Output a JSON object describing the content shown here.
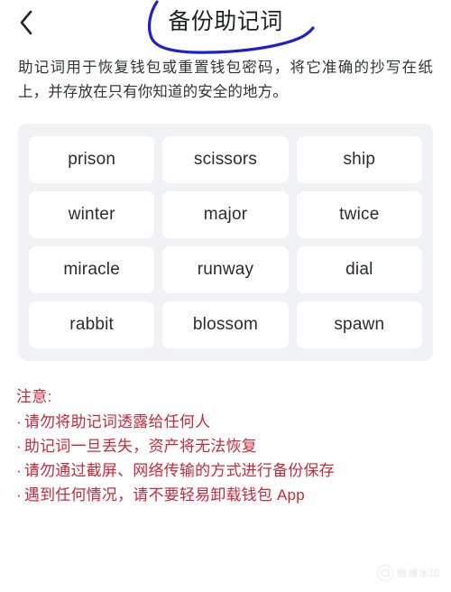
{
  "header": {
    "back_icon": "chevron-left-icon",
    "title": "备份助记词",
    "annotation_color": "#1f1fcc"
  },
  "description": "助记词用于恢复钱包或重置钱包密码，将它准确的抄写在纸上，并存放在只有你知道的安全的地方。",
  "mnemonic": {
    "panel_bg": "#f1f2f6",
    "chip_bg": "#ffffff",
    "rows": [
      [
        "prison",
        "scissors",
        "ship"
      ],
      [
        "winter",
        "major",
        "twice"
      ],
      [
        "miracle",
        "runway",
        "dial"
      ],
      [
        "rabbit",
        "blossom",
        "spawn"
      ]
    ]
  },
  "warning": {
    "color": "#c8293c",
    "title": "注意:",
    "bullet": "·",
    "items": [
      "请勿将助记词透露给任何人",
      "助记词一旦丢失，资产将无法恢复",
      "请勿通过截屏、网络传输的方式进行备份保存",
      "遇到任何情况，请不要轻易卸载钱包 App"
    ]
  },
  "watermark": {
    "label": "微博水印"
  }
}
